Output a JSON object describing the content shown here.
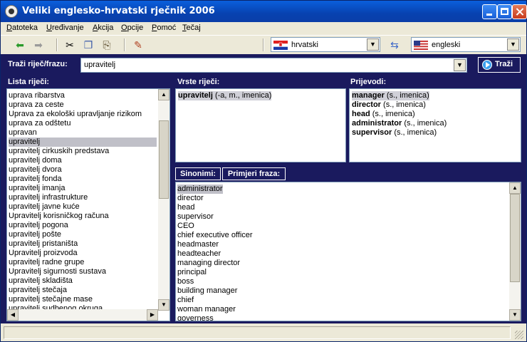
{
  "window": {
    "title": "Veliki englesko-hrvatski rječnik 2006"
  },
  "menu": [
    {
      "u": "D",
      "rest": "atoteka"
    },
    {
      "u": "U",
      "rest": "ređivanje"
    },
    {
      "u": "A",
      "rest": "kcija"
    },
    {
      "u": "O",
      "rest": "pcije"
    },
    {
      "u": "P",
      "rest": "omoć"
    },
    {
      "u": "T",
      "rest": "ečaj"
    }
  ],
  "toolbar": {
    "source_language": "hrvatski",
    "target_language": "engleski",
    "icons": [
      "back-arrow-icon",
      "forward-arrow-icon",
      "cut-icon",
      "copy-icon",
      "paste-icon",
      "user-edit-icon",
      "swap-languages-icon"
    ]
  },
  "search": {
    "label": "Traži riječ/frazu:",
    "value": "upravitelj",
    "button_label": "Traži"
  },
  "word_list": {
    "label": "Lista riječi:",
    "items": [
      "uprava ribarstva",
      "uprava za ceste",
      "Uprava za ekološki upravljanje rizikom",
      "uprava za odštetu",
      "upravan",
      "upravitelj",
      "upravitelj cirkuskih predstava",
      "upravitelj doma",
      "upravitelj dvora",
      "upravitelj fonda",
      "upravitelj imanja",
      "upravitelj infrastrukture",
      "upravitelj javne kuće",
      "Upravitelj korisničkog računa",
      "upravitelj pogona",
      "upravitelj pošte",
      "upravitelj pristaništa",
      "Upravitelj proizvoda",
      "upravitelj radne grupe",
      "Upravitelj sigurnosti sustava",
      "upravitelj skladišta",
      "upravitelj stečaja",
      "upravitelj stečajne mase",
      "upravitelj sudbenog okruga"
    ],
    "selected_index": 5
  },
  "word_types": {
    "label": "Vrste riječi:",
    "items": [
      {
        "word": "upravitelj",
        "info": "(-a, m., imenica)"
      }
    ]
  },
  "translations": {
    "label": "Prijevodi:",
    "items": [
      {
        "word": "manager",
        "info": "(s., imenica)"
      },
      {
        "word": "director",
        "info": "(s., imenica)"
      },
      {
        "word": "head",
        "info": "(s., imenica)"
      },
      {
        "word": "administrator",
        "info": "(s., imenica)"
      },
      {
        "word": "supervisor",
        "info": "(s., imenica)"
      }
    ]
  },
  "tabs": {
    "synonyms": "Sinonimi:",
    "examples": "Primjeri fraza:"
  },
  "synonyms": [
    "administrator",
    "director",
    "head",
    "supervisor",
    "CEO",
    "chief executive officer",
    "headmaster",
    "headteacher",
    "managing director",
    "principal",
    "boss",
    "building manager",
    "chief",
    "woman manager",
    "governess"
  ],
  "status": {
    "text": ""
  }
}
